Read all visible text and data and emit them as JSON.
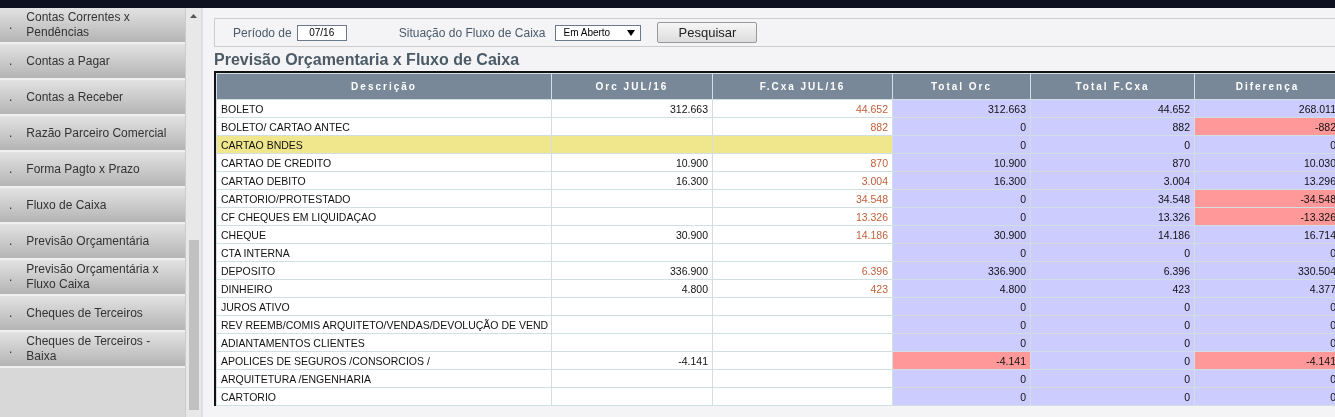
{
  "sidebar": {
    "items": [
      {
        "bullet": ".",
        "label": "Contas Correntes x Pendências"
      },
      {
        "bullet": ".",
        "label": "Contas a Pagar"
      },
      {
        "bullet": ".",
        "label": "Contas a Receber"
      },
      {
        "bullet": ".",
        "label": "Razão Parceiro Comercial"
      },
      {
        "bullet": ".",
        "label": "Forma Pagto x Prazo"
      },
      {
        "bullet": ".",
        "label": "Fluxo de Caixa"
      },
      {
        "bullet": ".",
        "label": "Previsão Orçamentária"
      },
      {
        "bullet": ".",
        "label": "Previsão Orçamentária x Fluxo Caixa"
      },
      {
        "bullet": ".",
        "label": "Cheques de Terceiros"
      },
      {
        "bullet": ".",
        "label": "Cheques de Terceiros - Baixa"
      }
    ]
  },
  "filters": {
    "period_label": "Período de",
    "period_value": "07/16",
    "status_label": "Situação do Fluxo de Caixa",
    "status_value": "Em Aberto",
    "search_button": "Pesquisar"
  },
  "title": "Previsão Orçamentaria x Fluxo de Caixa",
  "table": {
    "columns": [
      "Descrição",
      "Orc JUL/16",
      "F.Cxa JUL/16",
      "Total Orc",
      "Total F.Cxa",
      "Diferença"
    ],
    "rows": [
      {
        "description": "BOLETO",
        "highlighted": false,
        "orc": "312.663",
        "fcxa": "44.652",
        "totals": [
          {
            "value": "312.663",
            "alert": false
          },
          {
            "value": "44.652",
            "alert": false
          },
          {
            "value": "268.011",
            "alert": false
          }
        ]
      },
      {
        "description": "BOLETO/ CARTAO ANTEC",
        "highlighted": false,
        "fcxa": "882",
        "totals": [
          {
            "value": "0",
            "alert": false
          },
          {
            "value": "882",
            "alert": false
          },
          {
            "value": "-882",
            "alert": true
          }
        ]
      },
      {
        "description": "CARTAO BNDES",
        "highlighted": true,
        "totals": [
          {
            "value": "0",
            "alert": false
          },
          {
            "value": "0",
            "alert": false
          },
          {
            "value": "0",
            "alert": false
          }
        ]
      },
      {
        "description": "CARTAO DE CREDITO",
        "highlighted": false,
        "orc": "10.900",
        "fcxa": "870",
        "totals": [
          {
            "value": "10.900",
            "alert": false
          },
          {
            "value": "870",
            "alert": false
          },
          {
            "value": "10.030",
            "alert": false
          }
        ]
      },
      {
        "description": "CARTAO DEBITO",
        "highlighted": false,
        "orc": "16.300",
        "fcxa": "3.004",
        "totals": [
          {
            "value": "16.300",
            "alert": false
          },
          {
            "value": "3.004",
            "alert": false
          },
          {
            "value": "13.296",
            "alert": false
          }
        ]
      },
      {
        "description": "CARTORIO/PROTESTADO",
        "highlighted": false,
        "fcxa": "34.548",
        "totals": [
          {
            "value": "0",
            "alert": false
          },
          {
            "value": "34.548",
            "alert": false
          },
          {
            "value": "-34.548",
            "alert": true
          }
        ]
      },
      {
        "description": "CF CHEQUES EM LIQUIDAÇAO",
        "highlighted": false,
        "fcxa": "13.326",
        "totals": [
          {
            "value": "0",
            "alert": false
          },
          {
            "value": "13.326",
            "alert": false
          },
          {
            "value": "-13.326",
            "alert": true
          }
        ]
      },
      {
        "description": "CHEQUE",
        "highlighted": false,
        "orc": "30.900",
        "fcxa": "14.186",
        "totals": [
          {
            "value": "30.900",
            "alert": false
          },
          {
            "value": "14.186",
            "alert": false
          },
          {
            "value": "16.714",
            "alert": false
          }
        ]
      },
      {
        "description": "CTA INTERNA",
        "highlighted": false,
        "totals": [
          {
            "value": "0",
            "alert": false
          },
          {
            "value": "0",
            "alert": false
          },
          {
            "value": "0",
            "alert": false
          }
        ]
      },
      {
        "description": "DEPOSITO",
        "highlighted": false,
        "orc": "336.900",
        "fcxa": "6.396",
        "totals": [
          {
            "value": "336.900",
            "alert": false
          },
          {
            "value": "6.396",
            "alert": false
          },
          {
            "value": "330.504",
            "alert": false
          }
        ]
      },
      {
        "description": "DINHEIRO",
        "highlighted": false,
        "orc": "4.800",
        "fcxa": "423",
        "totals": [
          {
            "value": "4.800",
            "alert": false
          },
          {
            "value": "423",
            "alert": false
          },
          {
            "value": "4.377",
            "alert": false
          }
        ]
      },
      {
        "description": "JUROS ATIVO",
        "highlighted": false,
        "totals": [
          {
            "value": "0",
            "alert": false
          },
          {
            "value": "0",
            "alert": false
          },
          {
            "value": "0",
            "alert": false
          }
        ]
      },
      {
        "description": "REV REEMB/COMIS ARQUITETO/VENDAS/DEVOLUÇÃO DE VEND",
        "highlighted": false,
        "totals": [
          {
            "value": "0",
            "alert": false
          },
          {
            "value": "0",
            "alert": false
          },
          {
            "value": "0",
            "alert": false
          }
        ]
      },
      {
        "description": "ADIANTAMENTOS CLIENTES",
        "highlighted": false,
        "totals": [
          {
            "value": "0",
            "alert": false
          },
          {
            "value": "0",
            "alert": false
          },
          {
            "value": "0",
            "alert": false
          }
        ]
      },
      {
        "description": "APOLICES DE SEGUROS /CONSORCIOS /",
        "highlighted": false,
        "orc": "-4.141",
        "totals": [
          {
            "value": "-4.141",
            "alert": true
          },
          {
            "value": "0",
            "alert": false
          },
          {
            "value": "-4.141",
            "alert": true
          }
        ]
      },
      {
        "description": "ARQUITETURA /ENGENHARIA",
        "highlighted": false,
        "totals": [
          {
            "value": "0",
            "alert": false
          },
          {
            "value": "0",
            "alert": false
          },
          {
            "value": "0",
            "alert": false
          }
        ]
      },
      {
        "description": "CARTORIO",
        "highlighted": false,
        "totals": [
          {
            "value": "0",
            "alert": false
          },
          {
            "value": "0",
            "alert": false
          },
          {
            "value": "0",
            "alert": false
          }
        ]
      }
    ]
  }
}
